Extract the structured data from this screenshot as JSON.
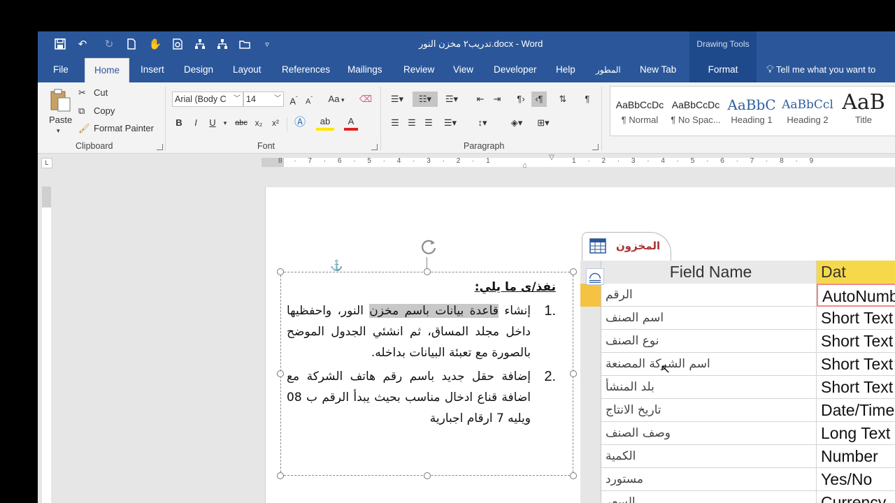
{
  "window": {
    "title": "تدريب٢ مخزن النور.docx  -  Word",
    "contextual_group": "Drawing Tools"
  },
  "tabs": [
    {
      "label": "File"
    },
    {
      "label": "Home"
    },
    {
      "label": "Insert"
    },
    {
      "label": "Design"
    },
    {
      "label": "Layout"
    },
    {
      "label": "References"
    },
    {
      "label": "Mailings"
    },
    {
      "label": "Review"
    },
    {
      "label": "View"
    },
    {
      "label": "Developer"
    },
    {
      "label": "Help"
    },
    {
      "label": "المطور"
    },
    {
      "label": "New Tab"
    },
    {
      "label": "Format"
    }
  ],
  "tell_me": "Tell me what you want to",
  "clipboard": {
    "paste": "Paste",
    "cut": "Cut",
    "copy": "Copy",
    "format_painter": "Format Painter",
    "label": "Clipboard"
  },
  "font": {
    "name": "Arial (Body C",
    "size": "14",
    "label": "Font",
    "bold": "B",
    "italic": "I",
    "underline": "U",
    "strike": "abc",
    "change_case": "Aa"
  },
  "paragraph": {
    "label": "Paragraph"
  },
  "styles": [
    {
      "preview": "AaBbCcDc",
      "name": "¶ Normal"
    },
    {
      "preview": "AaBbCcDc",
      "name": "¶ No Spac..."
    },
    {
      "preview": "AaBbC",
      "name": "Heading 1"
    },
    {
      "preview": "AaBbCcl",
      "name": "Heading 2"
    },
    {
      "preview": "AaB",
      "name": "Title"
    }
  ],
  "ruler": {
    "left_numbers": "8 · 7 · 6 · 5 · 4 · 3 · 2 · 1",
    "right_numbers": "1 · 2 · 3 · 4 · 5 · 6 · 7 · 8 · 9"
  },
  "document": {
    "heading": "نفذ/ى ما يلي:",
    "items": [
      {
        "num": ".1",
        "before": "إنشاء ",
        "highlight": "قاعدة بيانات باسم مخزن",
        "after": " النور، واحفظيها داخل مجلد المساق، ثم انشئي الجدول الموضح بالصورة مع تعبئة البيانات بداخله."
      },
      {
        "num": ".2",
        "before": "إضافة حقل جديد باسم رقم هاتف الشركة مع اضافة قناع ادخال مناسب بحيث يبدأ الرقم ب 08 ويليه 7 ارقام اجبارية",
        "highlight": "",
        "after": ""
      }
    ]
  },
  "access_table": {
    "tab_label": "المخزون",
    "headers": {
      "field": "Field Name",
      "type": "Dat"
    },
    "rows": [
      {
        "field": "الرقم",
        "type": "AutoNumb"
      },
      {
        "field": "اسم الصنف",
        "type": "Short Text"
      },
      {
        "field": "نوع الصنف",
        "type": "Short Text"
      },
      {
        "field": "اسم الشركة المصنعة",
        "type": "Short Text"
      },
      {
        "field": "بلد المنشأ",
        "type": "Short Text"
      },
      {
        "field": "تاريخ الانتاج",
        "type": "Date/Time"
      },
      {
        "field": "وصف الصنف",
        "type": "Long Text"
      },
      {
        "field": "الكمية",
        "type": "Number"
      },
      {
        "field": "مستورد",
        "type": "Yes/No"
      },
      {
        "field": "السعر",
        "type": "Currency"
      }
    ]
  }
}
